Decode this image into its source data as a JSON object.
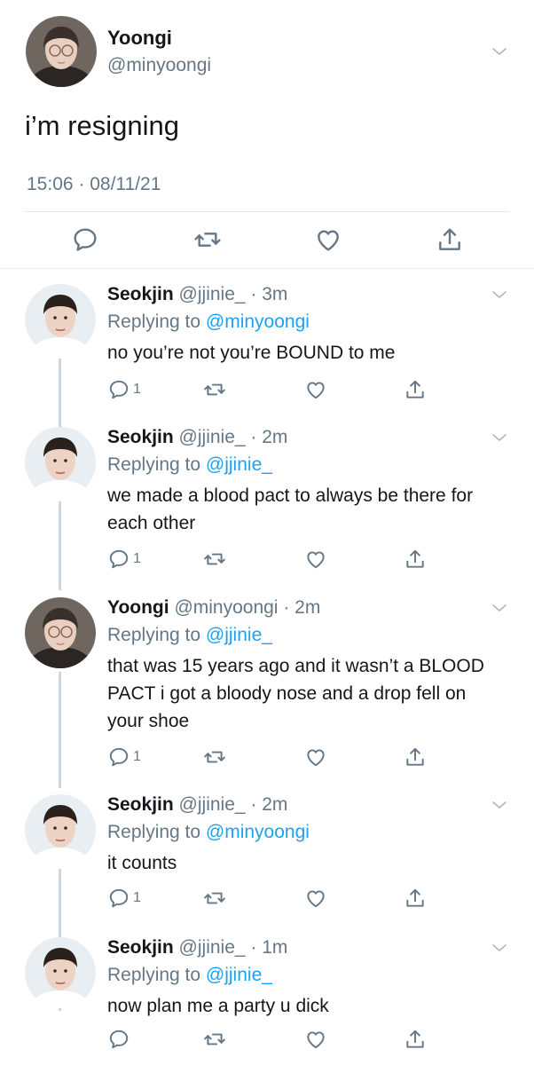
{
  "main": {
    "name": "Yoongi",
    "handle": "@minyoongi",
    "text": "i’m resigning",
    "timestamp": "15:06 · 08/11/21",
    "actions": [
      "reply-icon",
      "retweet-icon",
      "like-icon",
      "share-icon"
    ]
  },
  "replies": [
    {
      "name": "Seokjin",
      "handle": "@jjinie_",
      "time": "3m",
      "replying_label": "Replying to",
      "replying_to": "@minyoongi",
      "text": "no you’re not you’re BOUND to me",
      "reply_count": "1"
    },
    {
      "name": "Seokjin",
      "handle": "@jjinie_",
      "time": "2m",
      "replying_label": "Replying to",
      "replying_to": "@jjinie_",
      "text": "we made a blood pact to always be there for each other",
      "reply_count": "1"
    },
    {
      "name": "Yoongi",
      "handle": "@minyoongi",
      "time": "2m",
      "replying_label": "Replying to",
      "replying_to": "@jjinie_",
      "text": "that was 15 years ago and it wasn’t a BLOOD PACT i got a bloody nose and a drop fell on your shoe",
      "reply_count": "1"
    },
    {
      "name": "Seokjin",
      "handle": "@jjinie_",
      "time": "2m",
      "replying_label": "Replying to",
      "replying_to": "@minyoongi",
      "text": "it counts",
      "reply_count": "1"
    },
    {
      "name": "Seokjin",
      "handle": "@jjinie_",
      "time": "1m",
      "replying_label": "Replying to",
      "replying_to": "@jjinie_",
      "text": "now plan me a party u dick",
      "reply_count": ""
    }
  ],
  "colors": {
    "accent": "#1da1f2",
    "secondary_text": "#657786",
    "icon": "#657786",
    "divider": "#e1e8ed"
  }
}
